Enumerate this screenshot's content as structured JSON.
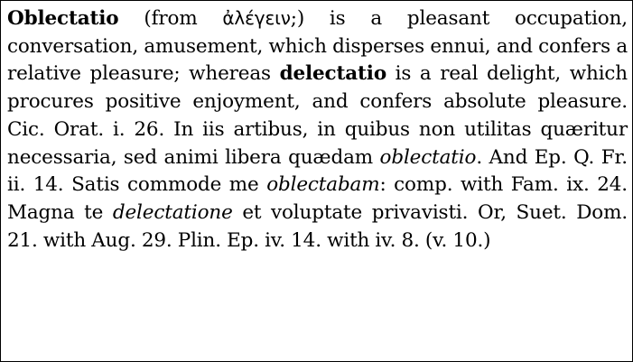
{
  "entry": {
    "headword": "Oblectatio",
    "etym_open": " (from ",
    "greek": "ἀλέγειν",
    "etym_close": ";)  is a pleasant occupation, conversation, amusement, which disperses ennui, and confers a relative pleasure; whereas ",
    "contrast_word": "delectatio",
    "definition_2": " is a real delight, which procures positive enjoyment, and confers absolute pleasure. Cic. Orat. i. 26. In iis artibus, in quibus non utilitas quæritur necessaria, sed animi libera quædam ",
    "cite_1": "oblectatio",
    "text_3": ". And Ep. Q. Fr. ii. 14. Satis commode me ",
    "cite_2": "oblectabam",
    "text_4": ": comp. with Fam. ix. 24. Magna te ",
    "cite_3": "delectatione",
    "text_5": " et voluptate privavisti. Or, Suet. Dom. 21. with Aug. 29. Plin. Ep. iv. 14. with iv. 8. (v. 10.)"
  }
}
